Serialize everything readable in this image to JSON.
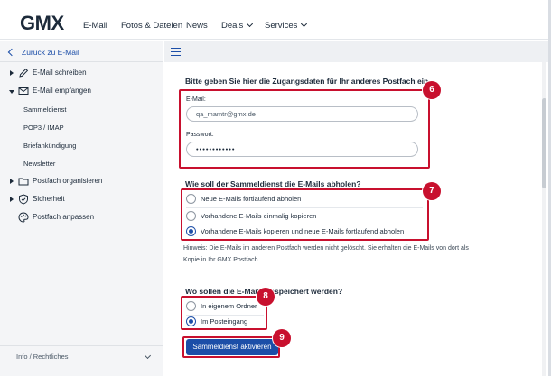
{
  "header": {
    "logo": "GMX",
    "nav": [
      {
        "label": "E-Mail"
      },
      {
        "label": "Fotos & Dateien"
      },
      {
        "label": "News"
      },
      {
        "label": "Deals"
      },
      {
        "label": "Services"
      }
    ]
  },
  "sidebar": {
    "back_label": "Zurück zu E-Mail",
    "items": [
      {
        "label": "E-Mail schreiben",
        "icon": "pencil-icon"
      },
      {
        "label": "E-Mail empfangen",
        "icon": "envelope-icon"
      },
      {
        "label": "Postfach organisieren",
        "icon": "folder-icon"
      },
      {
        "label": "Sicherheit",
        "icon": "shield-icon"
      },
      {
        "label": "Postfach anpassen",
        "icon": "palette-icon"
      }
    ],
    "subitems": [
      "Sammeldienst",
      "POP3 / IMAP",
      "Briefankündigung",
      "Newsletter"
    ],
    "footer": "Info / Rechtliches"
  },
  "form": {
    "section1_heading": "Bitte geben Sie hier die Zugangsdaten für Ihr anderes Postfach ein",
    "email_label": "E-Mail:",
    "email_value": "qa_mamtr@gmx.de",
    "password_label": "Passwort:",
    "password_value": "••••••••••••",
    "section2_heading": "Wie soll der Sammeldienst die E-Mails abholen?",
    "fetch_options": [
      {
        "label": "Neue E-Mails fortlaufend abholen",
        "selected": false
      },
      {
        "label": "Vorhandene E-Mails einmalig kopieren",
        "selected": false
      },
      {
        "label": "Vorhandene E-Mails kopieren und neue E-Mails fortlaufend abholen",
        "selected": true
      }
    ],
    "hint_line1": "Hinweis: Die E-Mails im anderen Postfach werden nicht gelöscht. Sie erhalten die E-Mails von dort als",
    "hint_line2": "Kopie in Ihr GMX Postfach.",
    "section3_heading": "Wo sollen die E-Mails gespeichert werden?",
    "store_options": [
      {
        "label": "In eigenem Ordner",
        "selected": false
      },
      {
        "label": "Im Posteingang",
        "selected": true
      }
    ],
    "submit_label": "Sammeldienst aktivieren"
  },
  "annotations": {
    "badge_6": "6",
    "badge_7": "7",
    "badge_8": "8",
    "badge_9": "9",
    "color": "#c8102e"
  },
  "colors": {
    "accent": "#1c4ea8",
    "sidebar_bg": "#f4f5f7"
  }
}
